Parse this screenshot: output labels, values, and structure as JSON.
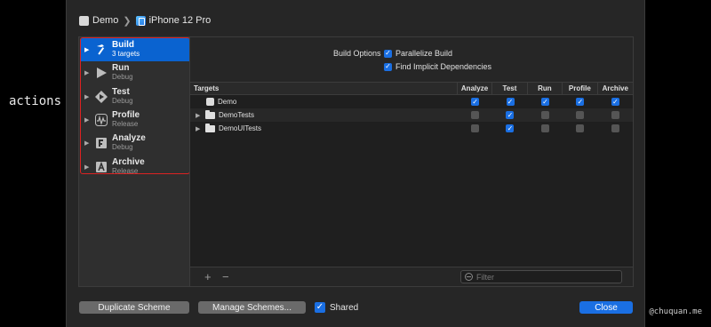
{
  "caption": "actions",
  "watermark": "@chuquan.me",
  "scheme": {
    "name": "Demo",
    "device": "iPhone 12 Pro"
  },
  "actions": [
    {
      "name": "Build",
      "sub": "3 targets",
      "selected": true,
      "icon": "hammer-icon"
    },
    {
      "name": "Run",
      "sub": "Debug",
      "icon": "play-triangle-icon"
    },
    {
      "name": "Test",
      "sub": "Debug",
      "icon": "test-diamond-icon"
    },
    {
      "name": "Profile",
      "sub": "Release",
      "icon": "waveform-icon"
    },
    {
      "name": "Analyze",
      "sub": "Debug",
      "icon": "analyze-icon"
    },
    {
      "name": "Archive",
      "sub": "Release",
      "icon": "archive-icon"
    }
  ],
  "build_options": {
    "label": "Build Options",
    "parallelize": {
      "label": "Parallelize Build",
      "checked": true
    },
    "implicit": {
      "label": "Find Implicit Dependencies",
      "checked": true
    }
  },
  "table": {
    "header_targets": "Targets",
    "columns": [
      "Analyze",
      "Test",
      "Run",
      "Profile",
      "Archive"
    ],
    "rows": [
      {
        "name": "Demo",
        "kind": "app",
        "expandable": false,
        "checks": [
          true,
          true,
          true,
          true,
          true
        ]
      },
      {
        "name": "DemoTests",
        "kind": "folder",
        "expandable": true,
        "checks": [
          false,
          true,
          false,
          false,
          false
        ]
      },
      {
        "name": "DemoUITests",
        "kind": "folder",
        "expandable": true,
        "checks": [
          false,
          true,
          false,
          false,
          false
        ]
      }
    ]
  },
  "bottom": {
    "add": "+",
    "remove": "−",
    "filter_placeholder": "Filter"
  },
  "buttons": {
    "duplicate": "Duplicate Scheme",
    "manage": "Manage Schemes...",
    "shared": "Shared",
    "shared_checked": true,
    "close": "Close"
  },
  "colors": {
    "accent": "#1a6fe3",
    "selection": "#0a63d0",
    "highlight_border": "#dd2222"
  }
}
